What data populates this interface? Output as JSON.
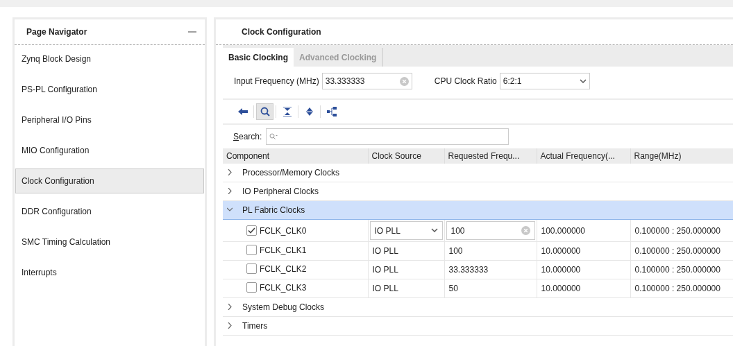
{
  "navigator": {
    "title": "Page Navigator",
    "items": [
      {
        "label": "Zynq Block Design",
        "selected": false
      },
      {
        "label": "PS-PL Configuration",
        "selected": false
      },
      {
        "label": "Peripheral I/O Pins",
        "selected": false
      },
      {
        "label": "MIO Configuration",
        "selected": false
      },
      {
        "label": "Clock Configuration",
        "selected": true
      },
      {
        "label": "DDR Configuration",
        "selected": false
      },
      {
        "label": "SMC Timing Calculation",
        "selected": false
      },
      {
        "label": "Interrupts",
        "selected": false
      }
    ]
  },
  "main": {
    "title": "Clock Configuration",
    "tabs": [
      {
        "label": "Basic Clocking",
        "selected": true
      },
      {
        "label": "Advanced Clocking",
        "selected": false
      }
    ],
    "input_frequency": {
      "label": "Input Frequency (MHz)",
      "value": "33.333333"
    },
    "cpu_clock_ratio": {
      "label": "CPU Clock Ratio",
      "value": "6:2:1"
    },
    "toolbar": [
      {
        "kind": "back",
        "selected": false
      },
      {
        "kind": "search",
        "selected": true
      },
      {
        "kind": "collapse",
        "selected": false
      },
      {
        "kind": "expand",
        "selected": false
      },
      {
        "kind": "hierarchy",
        "selected": false
      }
    ],
    "search": {
      "label": "Search:"
    },
    "table": {
      "columns": [
        "Component",
        "Clock Source",
        "Requested Frequ...",
        "Actual Frequency(...",
        "Range(MHz)"
      ],
      "rows": [
        {
          "name": "Processor/Memory Clocks",
          "expanded": false,
          "selected": false
        },
        {
          "name": "IO Peripheral Clocks",
          "expanded": false,
          "selected": false
        },
        {
          "name": "PL Fabric Clocks",
          "expanded": true,
          "selected": true,
          "children": [
            {
              "name": "FCLK_CLK0",
              "checked": true,
              "kind": "editing",
              "source": "IO PLL",
              "requested": "100",
              "actual": "100.000000",
              "range": "0.100000 : 250.000000"
            },
            {
              "name": "FCLK_CLK1",
              "checked": false,
              "kind": "plain",
              "source": "IO PLL",
              "requested": "100",
              "actual": "10.000000",
              "range": "0.100000 : 250.000000"
            },
            {
              "name": "FCLK_CLK2",
              "checked": false,
              "kind": "plain",
              "source": "IO PLL",
              "requested": "33.333333",
              "actual": "10.000000",
              "range": "0.100000 : 250.000000"
            },
            {
              "name": "FCLK_CLK3",
              "checked": false,
              "kind": "plain",
              "source": "IO PLL",
              "requested": "50",
              "actual": "10.000000",
              "range": "0.100000 : 250.000000"
            }
          ]
        },
        {
          "name": "System Debug Clocks",
          "expanded": false,
          "selected": false
        },
        {
          "name": "Timers",
          "expanded": false,
          "selected": false
        }
      ]
    }
  }
}
